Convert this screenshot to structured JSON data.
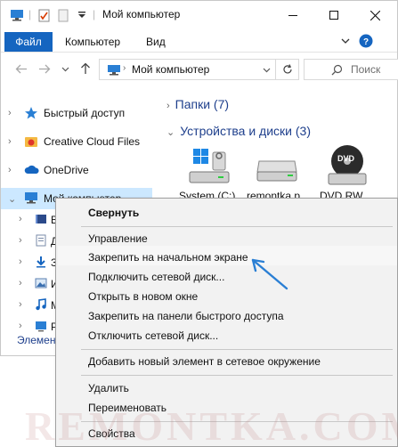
{
  "window": {
    "title": "Мой компьютер"
  },
  "ribbon": {
    "tabs": [
      "Файл",
      "Компьютер",
      "Вид"
    ]
  },
  "address_bar": {
    "path": "Мой компьютер",
    "search_placeholder": "Поиск"
  },
  "nav_pane": {
    "items": [
      {
        "label": "Быстрый доступ",
        "icon": "star-icon"
      },
      {
        "label": "Creative Cloud Files",
        "icon": "creative-cloud-icon"
      },
      {
        "label": "OneDrive",
        "icon": "onedrive-icon"
      },
      {
        "label": "Мой компьютер",
        "icon": "computer-icon"
      }
    ],
    "sub_items": [
      {
        "label": "В",
        "icon": "video-icon"
      },
      {
        "label": "Д",
        "icon": "documents-icon"
      },
      {
        "label": "З",
        "icon": "downloads-icon"
      },
      {
        "label": "И",
        "icon": "pictures-icon"
      },
      {
        "label": "М",
        "icon": "music-icon"
      },
      {
        "label": "Р",
        "icon": "desktop-icon"
      }
    ]
  },
  "content": {
    "folders_header": "Папки (7)",
    "devices_header": "Устройства и диски (3)",
    "devices": [
      {
        "label": "System (C:)",
        "icon": "system-drive-icon"
      },
      {
        "label": "remontka.p",
        "icon": "drive-icon"
      },
      {
        "label": "DVD RW",
        "icon": "dvd-icon",
        "badge": "DVD"
      }
    ]
  },
  "status": {
    "text": "Элемент"
  },
  "context_menu": {
    "items": [
      {
        "label": "Свернуть",
        "bold": true
      },
      {
        "label": "Управление"
      },
      {
        "label": "Закрепить на начальном экране"
      },
      {
        "label": "Подключить сетевой диск..."
      },
      {
        "label": "Открыть в новом окне"
      },
      {
        "label": "Закрепить на панели быстрого доступа"
      },
      {
        "label": "Отключить сетевой диск..."
      },
      {
        "label": "Добавить новый элемент в сетевое окружение"
      },
      {
        "label": "Удалить"
      },
      {
        "label": "Переименовать"
      },
      {
        "label": "Свойства"
      }
    ]
  },
  "watermark": "REMONTKA.COM",
  "colors": {
    "accent": "#1565c0",
    "selection": "#cce8ff",
    "arrow": "#2a7fd4"
  }
}
